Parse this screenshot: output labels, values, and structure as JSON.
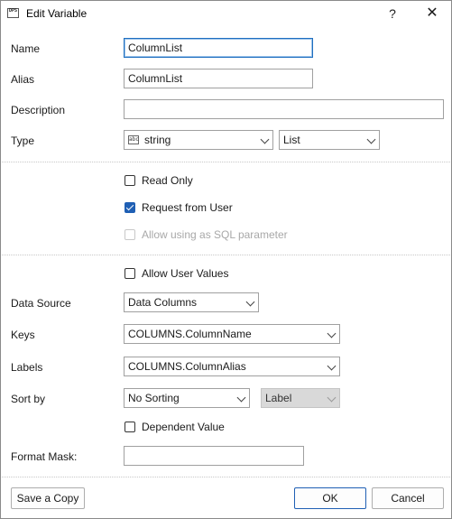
{
  "window": {
    "title": "Edit Variable",
    "help_glyph": "?",
    "close_glyph": "✕",
    "app_icon_text": "DPS"
  },
  "fields": {
    "name": {
      "label": "Name",
      "value": "ColumnList"
    },
    "alias": {
      "label": "Alias",
      "value": "ColumnList"
    },
    "description": {
      "label": "Description",
      "value": ""
    },
    "type": {
      "label": "Type",
      "value": "string",
      "icon_text": "abc",
      "kind": "List"
    }
  },
  "options": {
    "read_only": {
      "label": "Read Only",
      "checked": false
    },
    "request_from_user": {
      "label": "Request from User",
      "checked": true
    },
    "allow_sql": {
      "label": "Allow using as SQL parameter",
      "checked": false,
      "disabled": true
    }
  },
  "source": {
    "allow_user_values": {
      "label": "Allow User Values",
      "checked": false
    },
    "data_source": {
      "label": "Data Source",
      "value": "Data Columns"
    },
    "keys": {
      "label": "Keys",
      "value": "COLUMNS.ColumnName"
    },
    "labels": {
      "label": "Labels",
      "value": "COLUMNS.ColumnAlias"
    },
    "sort_by": {
      "label": "Sort by",
      "value": "No Sorting",
      "secondary": "Label"
    },
    "dependent_value": {
      "label": "Dependent Value",
      "checked": false
    },
    "format_mask": {
      "label": "Format Mask:",
      "value": ""
    }
  },
  "buttons": {
    "save_copy": "Save a Copy",
    "ok": "OK",
    "cancel": "Cancel"
  },
  "colors": {
    "accent": "#1f5fb4",
    "focus_border": "#1f6fc0"
  }
}
